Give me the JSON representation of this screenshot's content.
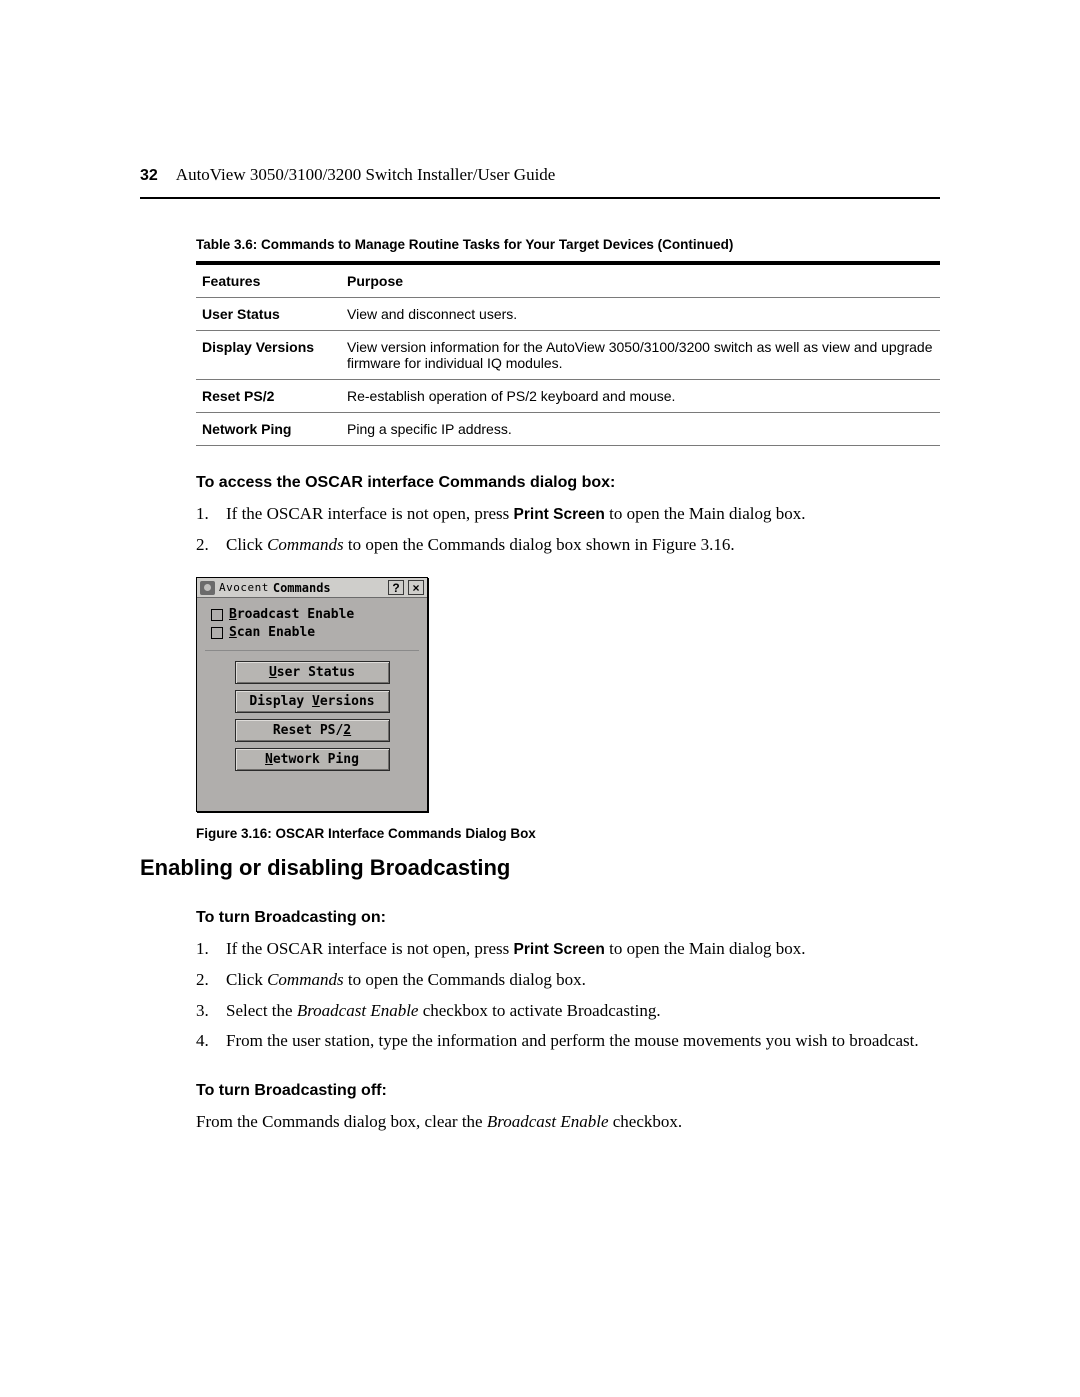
{
  "header": {
    "page_number": "32",
    "title": "AutoView 3050/3100/3200 Switch Installer/User Guide"
  },
  "table": {
    "caption": "Table 3.6: Commands to Manage Routine Tasks for Your Target Devices (Continued)",
    "col_feature": "Features",
    "col_purpose": "Purpose",
    "rows": [
      {
        "feature": "User Status",
        "purpose": "View and disconnect users."
      },
      {
        "feature": "Display Versions",
        "purpose": "View version information for the AutoView 3050/3100/3200 switch as well as view and upgrade firmware for individual IQ modules."
      },
      {
        "feature": "Reset PS/2",
        "purpose": "Re-establish operation of PS/2 keyboard and mouse."
      },
      {
        "feature": "Network Ping",
        "purpose": "Ping a specific IP address."
      }
    ]
  },
  "proc1": {
    "heading": "To access the OSCAR interface Commands dialog box:",
    "step1_a": "If the OSCAR interface is not open, press ",
    "step1_bold": "Print Screen",
    "step1_b": " to open the Main dialog box.",
    "step2_a": "Click ",
    "step2_i": "Commands",
    "step2_b": " to open the Commands dialog box shown in Figure 3.16."
  },
  "dialog": {
    "brand": "Avocent",
    "title": "Commands",
    "help_glyph": "?",
    "close_glyph": "×",
    "broadcast_prefix": "B",
    "broadcast_rest": "roadcast Enable",
    "scan_prefix": "S",
    "scan_rest": "can Enable",
    "btn_user_u": "U",
    "btn_user_rest": "ser Status",
    "btn_disp_pre": "Display ",
    "btn_disp_u": "V",
    "btn_disp_rest": "ersions",
    "btn_reset_pre": "Reset PS/",
    "btn_reset_u": "2",
    "btn_net_u": "N",
    "btn_net_rest": "etwork Ping"
  },
  "figure_caption": "Figure 3.16: OSCAR Interface Commands Dialog Box",
  "section2_title": "Enabling or disabling Broadcasting",
  "proc2": {
    "heading": "To turn Broadcasting on:",
    "s1a": "If the OSCAR interface is not open, press ",
    "s1bold": "Print Screen",
    "s1b": " to open the Main dialog box.",
    "s2a": "Click ",
    "s2i": "Commands",
    "s2b": " to open the Commands dialog box.",
    "s3a": "Select the ",
    "s3i": "Broadcast Enable",
    "s3b": " checkbox to activate Broadcasting.",
    "s4": "From the user station, type the information and perform the mouse movements you wish to broadcast."
  },
  "proc3": {
    "heading": "To turn Broadcasting off:",
    "body_a": "From the Commands dialog box, clear the ",
    "body_i": "Broadcast Enable",
    "body_b": " checkbox."
  }
}
